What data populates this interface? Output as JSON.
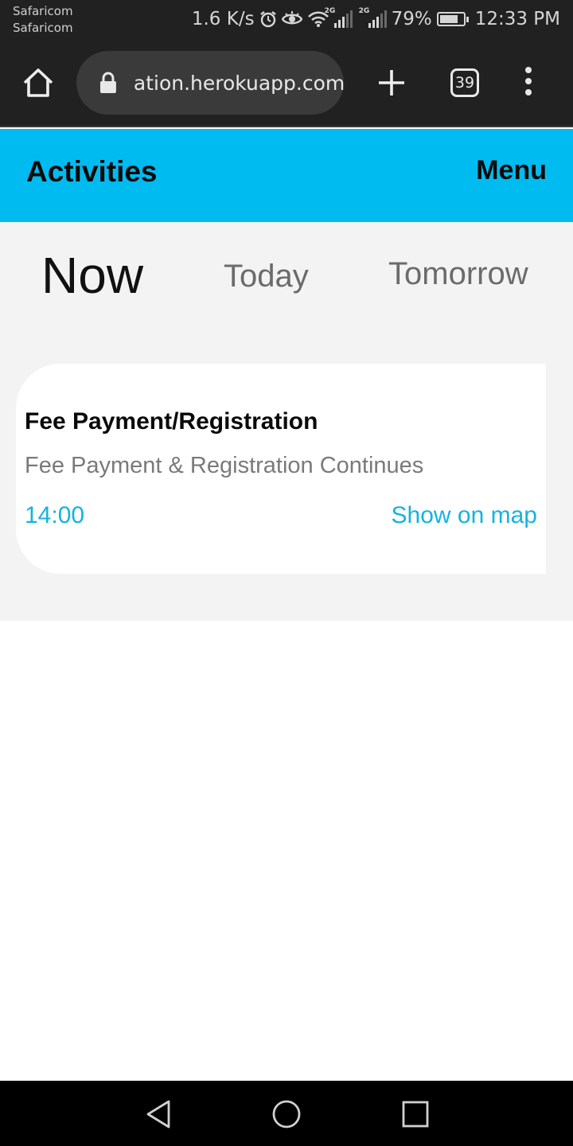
{
  "status_bar": {
    "carrier_1": "Safaricom",
    "carrier_2": "Safaricom",
    "net_speed": "1.6 K/s",
    "network_1": "2G",
    "network_2": "2G",
    "battery": "79%",
    "battery_level": 0.79,
    "time": "12:33 PM",
    "icons": [
      "alarm-icon",
      "eye-icon",
      "wifi-icon",
      "signal-icon",
      "signal-icon",
      "battery-icon"
    ]
  },
  "browser": {
    "url": "ation.herokuapp.com",
    "tab_count": "39",
    "icons": [
      "home-icon",
      "lock-icon",
      "plus-icon",
      "more-icon"
    ]
  },
  "header": {
    "title": "Activities",
    "menu_label": "Menu",
    "color": "#00bbef"
  },
  "tabs": {
    "now": "Now",
    "today": "Today",
    "tomorrow": "Tomorrow"
  },
  "activities": [
    {
      "title": "Fee Payment/Registration",
      "description": "Fee Payment & Registration Continues",
      "time": "14:00",
      "map_link": "Show on map"
    }
  ],
  "nav": {
    "icons": [
      "back-icon",
      "home-circle-icon",
      "recents-icon"
    ]
  },
  "colors": {
    "accent": "#14b3e0",
    "header": "#00bbef",
    "browser_bar": "#212121"
  }
}
